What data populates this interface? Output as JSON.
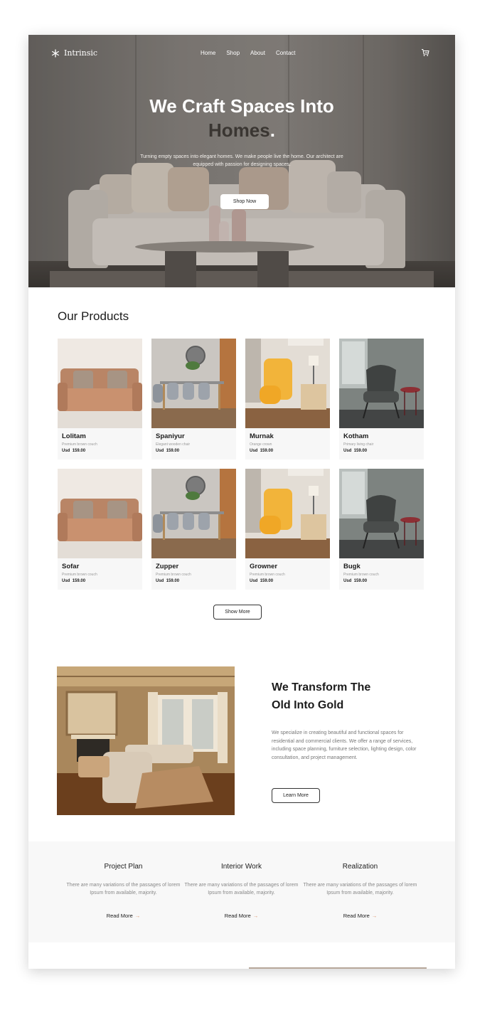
{
  "brand": {
    "name": "Intrinsic",
    "logo_icon": "snowflake-icon"
  },
  "nav": {
    "links": [
      "Home",
      "Shop",
      "About",
      "Contact"
    ],
    "cart_icon": "cart-icon"
  },
  "hero": {
    "title_line1": "We Craft Spaces Into",
    "title_line2": "Homes",
    "title_dot": ".",
    "subtitle": "Turning empty spaces into elegant homes. We make people live the home. Our architect are equipped with passion for designing spaces.",
    "cta_label": "Shop Now"
  },
  "products": {
    "title": "Our Products",
    "items": [
      {
        "name": "Lolitam",
        "desc": "Premium brown couch",
        "currency": "Usd",
        "price": "159.00"
      },
      {
        "name": "Spaniyur",
        "desc": "Elegant wooden chair",
        "currency": "Usd",
        "price": "159.00"
      },
      {
        "name": "Murnak",
        "desc": "Orange crown",
        "currency": "Usd",
        "price": "159.00"
      },
      {
        "name": "Kotham",
        "desc": "Primary living chair",
        "currency": "Usd",
        "price": "159.00"
      },
      {
        "name": "Sofar",
        "desc": "Premium brown couch",
        "currency": "Usd",
        "price": "159.00"
      },
      {
        "name": "Zupper",
        "desc": "Premium brown couch",
        "currency": "Usd",
        "price": "159.00"
      },
      {
        "name": "Growner",
        "desc": "Premium brown couch",
        "currency": "Usd",
        "price": "159.00"
      },
      {
        "name": "Bugk",
        "desc": "Premium brown couch",
        "currency": "Usd",
        "price": "159.00"
      }
    ],
    "show_more_label": "Show More"
  },
  "about": {
    "title_line1": "We Transform The",
    "title_line2": "Old Into Gold",
    "text": "We specialize in creating beautiful and functional spaces for residential and commercial clients. We offer a range of services, including space planning, furniture selection, lighting design, color consultation, and project management.",
    "cta_label": "Learn More"
  },
  "features": [
    {
      "title": "Project Plan",
      "text": "There are many variations of the passages of lorem Ipsum from available, majority.",
      "link": "Read More",
      "arrow": "→"
    },
    {
      "title": "Interior Work",
      "text": "There are many variations of the passages of lorem Ipsum from available, majority.",
      "link": "Read More",
      "arrow": "→"
    },
    {
      "title": "Realization",
      "text": "There are many variations of the passages of lorem Ipsum from available, majority.",
      "link": "Read More",
      "arrow": "→"
    }
  ],
  "colors": {
    "accent": "#d98b5f",
    "dark_text": "#1c1c1c",
    "muted_text": "#888888",
    "feature_bg": "#f8f8f8"
  }
}
